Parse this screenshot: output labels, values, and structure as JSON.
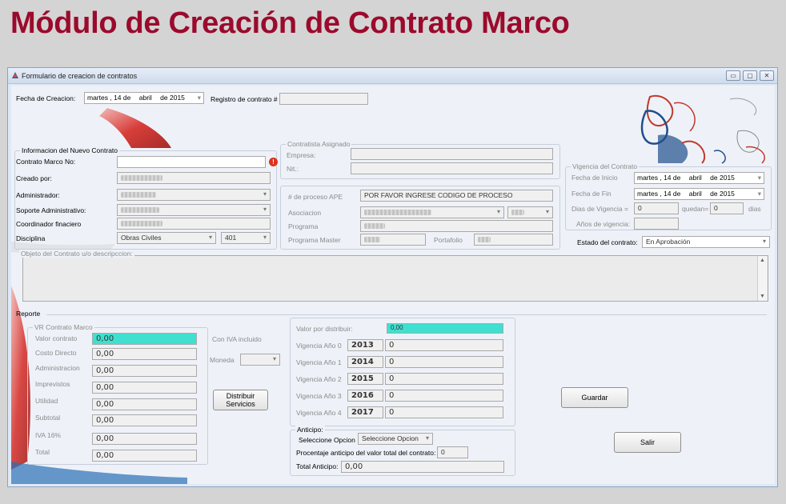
{
  "slide_title": "Módulo de Creación de Contrato Marco",
  "window": {
    "title": "Formulario de creacion de contratos",
    "controls": [
      "▭",
      "▢",
      "✕"
    ]
  },
  "header": {
    "fecha_label": "Fecha de Creacion:",
    "fecha": {
      "dow": "martes",
      "day": ", 14 de",
      "month": "abril",
      "year": "de 2015"
    },
    "registro_label": "Registro de contrato #",
    "registro_value": ""
  },
  "info": {
    "group_title": "Informacion del Nuevo Contrato",
    "contrato_no_label": "Contrato Marco No:",
    "contrato_no_value": "",
    "creado_label": "Creado por:",
    "administrador_label": "Administrador:",
    "soporte_label": "Soporte Administrativo:",
    "coordinador_label": "Coordinador finaciero",
    "disciplina_label": "Disciplina",
    "disciplina_value": "Obras Civiles",
    "disciplina_code": "401"
  },
  "contratista": {
    "group_title": "Contratista Asignado",
    "empresa_label": "Empresa:",
    "nit_label": "Nit.:"
  },
  "proceso": {
    "proceso_label": "# de proceso APE",
    "proceso_value": "POR FAVOR INGRESE CODIGO DE PROCESO",
    "asociacion_label": "Asociacion",
    "programa_label": "Programa",
    "programa_master_label": "Programa Master",
    "portafolio_label": "Portafolio"
  },
  "vigencia": {
    "group_title": "Vigencia del Contrato",
    "inicio_label": "Fecha de Inicio",
    "inicio": {
      "dow": "martes",
      "day": ", 14 de",
      "month": "abril",
      "year": "de 2015"
    },
    "fin_label": "Fecha de Fin",
    "fin": {
      "dow": "martes",
      "day": ", 14 de",
      "month": "abril",
      "year": "de 2015"
    },
    "dias_label": "Dias de Vigencia =",
    "dias_value": "0",
    "quedan_label": "quedan=",
    "quedan_value": "0",
    "dias_unit": "dias",
    "anios_label": "Años de vigencia:",
    "anios_value": ""
  },
  "estado": {
    "label": "Estado del contrato:",
    "value": "En Aprobación"
  },
  "objeto": {
    "label": "Objeto del Contrato u/o descripccion:",
    "value": ""
  },
  "reporte": {
    "group_title": "Reporte",
    "vr_title": "VR Contrato Marco",
    "rows": [
      {
        "label": "Valor contrato",
        "value": "0,00"
      },
      {
        "label": "Costo Directo",
        "value": "0,00"
      },
      {
        "label": "Administracion",
        "value": "0,00"
      },
      {
        "label": "Imprevistos",
        "value": "0,00"
      },
      {
        "label": "Utilidad",
        "value": "0,00"
      },
      {
        "label": "Subtotal",
        "value": "0,00"
      },
      {
        "label": "IVA 16%",
        "value": "0,00"
      },
      {
        "label": "Total",
        "value": "0,00"
      }
    ],
    "iva_label": "Con IVA incluido",
    "moneda_label": "Moneda",
    "moneda_value": "",
    "distribuir_label_1": "Distribuir",
    "distribuir_label_2": "Servicios"
  },
  "distribucion": {
    "valor_label": "Valor por distribuir:",
    "valor_value": "0,00",
    "years": [
      {
        "label": "Vigencia Año 0",
        "year": "2013",
        "value": "0"
      },
      {
        "label": "Vigencia Año 1",
        "year": "2014",
        "value": "0"
      },
      {
        "label": "Vigencia Año 2",
        "year": "2015",
        "value": "0"
      },
      {
        "label": "Vigencia Año 3",
        "year": "2016",
        "value": "0"
      },
      {
        "label": "Vigencia Año 4",
        "year": "2017",
        "value": "0"
      }
    ]
  },
  "anticipo": {
    "group_title": "Anticipo:",
    "opcion_label": "Seleccione Opcion",
    "opcion_value": "Seleccione Opcion",
    "porcentaje_label": "Procentaje anticipo del valor total del contrato:",
    "porcentaje_value": "0",
    "total_label": "Total Anticipo:",
    "total_value": "0,00"
  },
  "actions": {
    "guardar": "Guardar",
    "salir": "Salir"
  },
  "colors": {
    "title": "#9b0a2c",
    "highlight": "#40e0d0",
    "error": "#e0301e"
  }
}
